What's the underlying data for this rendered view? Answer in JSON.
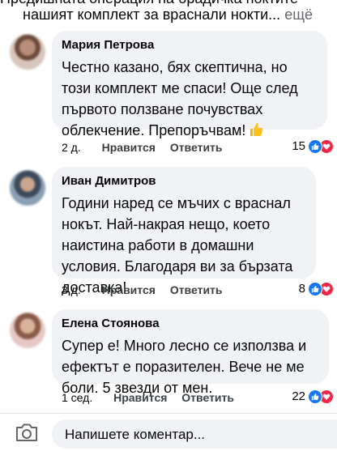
{
  "post_excerpt": {
    "line1": "Предишната операция на брадичка ноктите",
    "line2": "нашият комплект за враснали нокти...",
    "more": "ещё"
  },
  "comments": [
    {
      "author": "Мария Петрова",
      "text": "Честно казано, бях скептична, но този комплект ме спаси! Още след първото ползване почувствах облекчение. Препоръчвам!",
      "emoji": "thumbs-up",
      "time": "2 д.",
      "like_label": "Нравится",
      "reply_label": "Ответить",
      "reaction_count": "15"
    },
    {
      "author": "Иван Димитров",
      "text": "Години наред се мъчих с враснал нокът. Най-накрая нещо, което наистина работи в домашни условия. Благодаря ви за бързата доставка!",
      "time": "3 д.",
      "like_label": "Нравится",
      "reply_label": "Ответить",
      "reaction_count": "8"
    },
    {
      "author": "Елена Стоянова",
      "text": "Супер е! Много лесно се използва и ефектът е поразителен. Вече не ме боли. 5 звезди от мен.",
      "time": "1 сед.",
      "like_label": "Нравится",
      "reply_label": "Ответить",
      "reaction_count": "22"
    }
  ],
  "composer": {
    "placeholder": "Напишете коментар..."
  },
  "colors": {
    "bubble": "#f0f2f5",
    "like_blue": "#1877f2",
    "love_red": "#f02849",
    "muted": "#65676b"
  },
  "icons": [
    "camera-icon",
    "like-icon",
    "love-icon",
    "thumbs-up-icon"
  ]
}
